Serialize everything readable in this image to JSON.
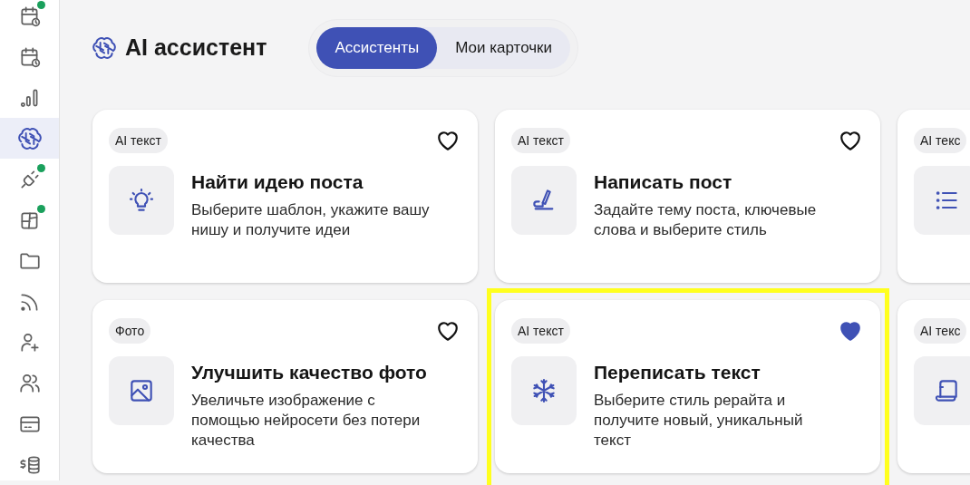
{
  "sidebar": {
    "items": [
      {
        "selected": false,
        "notification": true
      },
      {
        "selected": false,
        "notification": false
      },
      {
        "selected": false,
        "notification": false
      },
      {
        "selected": true,
        "notification": false
      },
      {
        "selected": false,
        "notification": true
      },
      {
        "selected": false,
        "notification": true
      },
      {
        "selected": false,
        "notification": false
      },
      {
        "selected": false,
        "notification": false
      },
      {
        "selected": false,
        "notification": false
      },
      {
        "selected": false,
        "notification": false
      },
      {
        "selected": false,
        "notification": false
      },
      {
        "selected": false,
        "notification": false
      }
    ]
  },
  "header": {
    "title": "AI ассистент",
    "tabs": [
      {
        "label": "Ассистенты",
        "selected": true
      },
      {
        "label": "Мои карточки",
        "selected": false
      }
    ]
  },
  "cards": [
    {
      "tag": "AI текст",
      "title": "Найти идею поста",
      "description": "Выберите шаблон, укажите вашу нишу и получите идеи",
      "favorite": false,
      "highlighted": false
    },
    {
      "tag": "AI текст",
      "title": "Написать пост",
      "description": "Задайте тему поста, ключевые слова и выберите стиль",
      "favorite": false,
      "highlighted": false
    },
    {
      "tag": "AI текс",
      "highlighted": false
    },
    {
      "tag": "Фото",
      "title": "Улучшить качество фото",
      "description": "Увеличьте изображение с помощью нейросети без потери качества",
      "favorite": false,
      "highlighted": false
    },
    {
      "tag": "AI текст",
      "title": "Переписать текст",
      "description": "Выберите стиль рерайта и получите новый, уникальный текст",
      "favorite": true,
      "highlighted": true
    },
    {
      "tag": "AI текс",
      "highlighted": false
    }
  ]
}
